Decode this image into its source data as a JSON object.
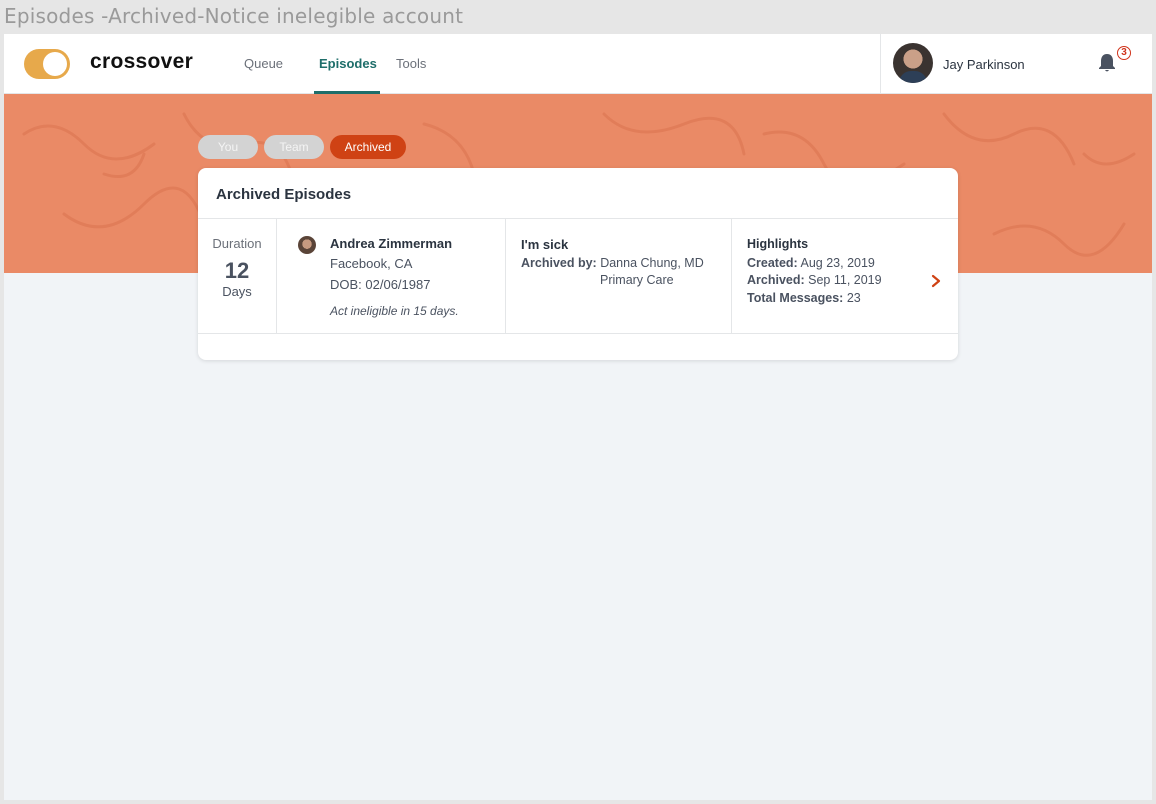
{
  "frame": {
    "title": "Episodes -Archived-Notice inelegible account"
  },
  "header": {
    "logo": "crossover",
    "nav": [
      {
        "label": "Queue"
      },
      {
        "label": "Episodes",
        "active": true
      },
      {
        "label": "Tools"
      }
    ],
    "user": {
      "name": "Jay Parkinson"
    },
    "notifications": {
      "count": "3",
      "icon": "bell-icon"
    }
  },
  "filters": {
    "pills": [
      {
        "label": "You"
      },
      {
        "label": "Team"
      },
      {
        "label": "Archived",
        "active": true
      }
    ]
  },
  "card": {
    "title": "Archived Episodes",
    "episode": {
      "duration_label": "Duration",
      "duration_value": "12",
      "duration_unit": "Days",
      "patient": {
        "name": "Andrea Zimmerman",
        "location": "Facebook, CA",
        "dob": "DOB: 02/06/1987",
        "note": "Act ineligible in 15 days."
      },
      "title": "I'm sick",
      "archived_by_label": "Archived by:",
      "archived_by_value": "Danna Chung, MD",
      "department": "Primary Care",
      "highlights": {
        "title": "Highlights",
        "created_label": "Created:",
        "created_value": "Aug 23, 2019",
        "archived_label": "Archived:",
        "archived_value": "Sep 11, 2019",
        "messages_label": "Total Messages:",
        "messages_value": "23"
      }
    }
  },
  "colors": {
    "brand_teal": "#1e6e6a",
    "banner": "#ea8a66",
    "accent_orange": "#cf4214",
    "toggle": "#e7a94b"
  }
}
